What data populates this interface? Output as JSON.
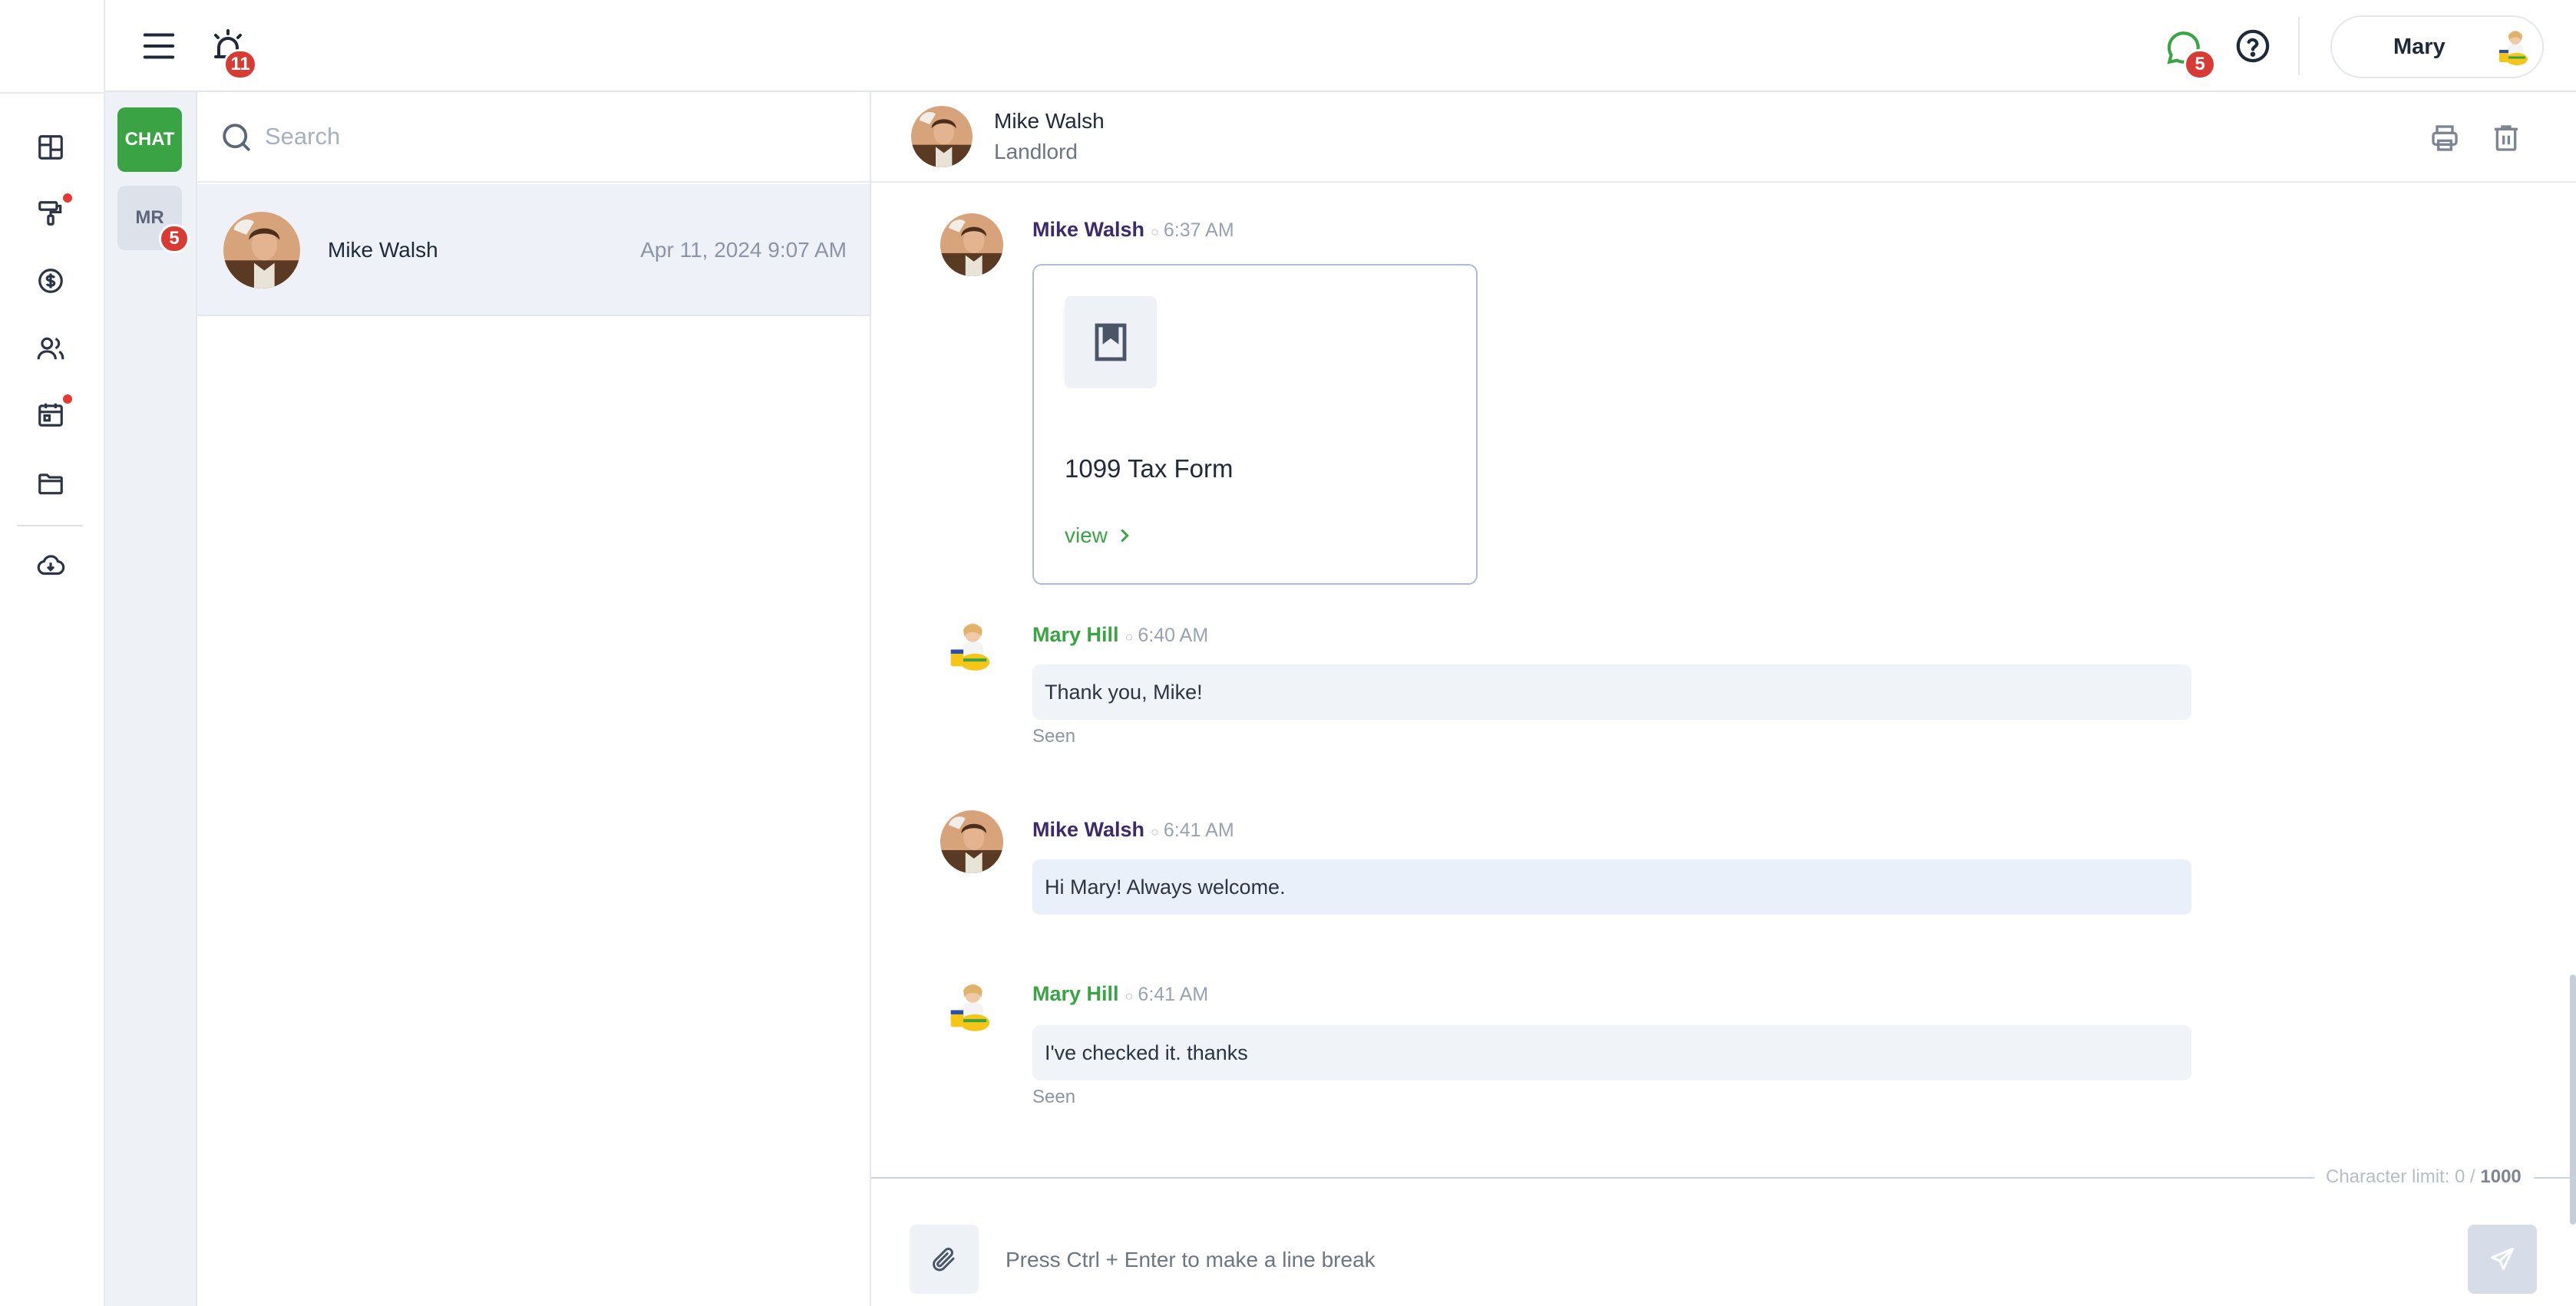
{
  "topbar": {
    "menu_icon": "hamburger-icon",
    "alarm_icon": "alarm-icon",
    "alarm_count": "11",
    "chat_icon": "chat-bubble-icon",
    "chat_count": "5",
    "help_icon": "help-icon",
    "user_name": "Mary"
  },
  "rail": {
    "items": [
      {
        "icon": "dashboard-icon",
        "has_dot": false
      },
      {
        "icon": "paint-roller-icon",
        "has_dot": true
      },
      {
        "icon": "dollar-icon",
        "has_dot": false
      },
      {
        "icon": "users-icon",
        "has_dot": false
      },
      {
        "icon": "calendar-icon",
        "has_dot": true
      },
      {
        "icon": "folder-icon",
        "has_dot": false
      },
      {
        "icon": "cloud-download-icon",
        "has_dot": false
      }
    ]
  },
  "chat_types": {
    "chat_label": "CHAT",
    "mr_label": "MR",
    "mr_count": "5"
  },
  "conversations": {
    "search_placeholder": "Search",
    "items": [
      {
        "name": "Mike Walsh",
        "date": "Apr 11, 2024 9:07 AM"
      }
    ]
  },
  "chat": {
    "header": {
      "name": "Mike Walsh",
      "role": "Landlord"
    },
    "messages": [
      {
        "sender": "Mike Walsh",
        "time": "6:37 AM",
        "type": "document",
        "doc_title": "1099 Tax Form",
        "doc_link": "view"
      },
      {
        "sender": "Mary Hill",
        "time": "6:40 AM",
        "type": "text",
        "text": "Thank you, Mike!",
        "status": "Seen"
      },
      {
        "sender": "Mike Walsh",
        "time": "6:41 AM",
        "type": "text",
        "text": "Hi Mary! Always welcome."
      },
      {
        "sender": "Mary Hill",
        "time": "6:41 AM",
        "type": "text",
        "text": "I've checked it. thanks",
        "status": "Seen"
      }
    ],
    "composer": {
      "char_limit_label": "Character limit: 0 /",
      "char_limit_max": "1000",
      "placeholder": "Press Ctrl + Enter to make a line break"
    }
  },
  "colors": {
    "accent_green": "#3aa344",
    "badge_red": "#d83a34",
    "sender_purple": "#3d2a6b"
  }
}
